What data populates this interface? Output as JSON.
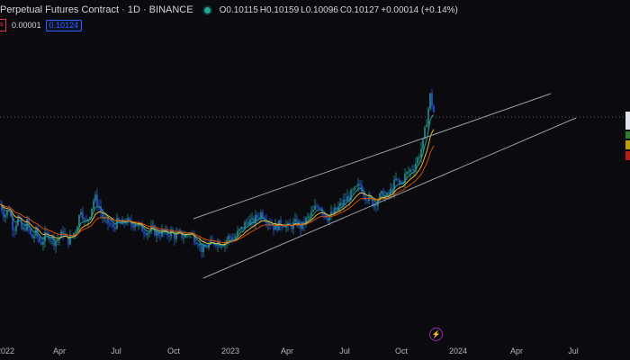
{
  "header": {
    "title": "Perpetual Futures Contract · 1D · BINANCE",
    "ohlc": {
      "open": "O0.10115",
      "high": "H0.10159",
      "low": "L0.10096",
      "close": "C0.10127",
      "change": "+0.00014 (+0.14%)"
    }
  },
  "indicator": {
    "value": "0.00001",
    "price_box": "0.10124"
  },
  "colors": {
    "up": "#26a69a",
    "down": "#2962ff",
    "ema_fast": "#26a69a",
    "ema_mid": "#fbc02d",
    "ema_slow": "#e65100",
    "channel": "#9aa0a6"
  },
  "icons": {
    "status": "status-dot-icon",
    "events": "flash-icon"
  },
  "chart_data": {
    "type": "candlestick",
    "x_ticks": [
      "2022",
      "Apr",
      "Jul",
      "Oct",
      "2023",
      "Apr",
      "Jul",
      "Oct",
      "2024",
      "Apr",
      "Jul"
    ],
    "current_price": 0.10127,
    "grid": false,
    "series": [
      {
        "name": "",
        "kind": "price-path",
        "points": [
          [
            0,
            0.062
          ],
          [
            5,
            0.057
          ],
          [
            10,
            0.06
          ],
          [
            15,
            0.051
          ],
          [
            20,
            0.056
          ],
          [
            25,
            0.05
          ],
          [
            30,
            0.054
          ],
          [
            35,
            0.047
          ],
          [
            40,
            0.05
          ],
          [
            45,
            0.045
          ],
          [
            50,
            0.048
          ],
          [
            55,
            0.049
          ],
          [
            60,
            0.046
          ],
          [
            65,
            0.047
          ],
          [
            70,
            0.05
          ],
          [
            75,
            0.046
          ],
          [
            80,
            0.048
          ],
          [
            85,
            0.052
          ],
          [
            90,
            0.06
          ],
          [
            95,
            0.053
          ],
          [
            100,
            0.058
          ],
          [
            105,
            0.065
          ],
          [
            110,
            0.061
          ],
          [
            115,
            0.055
          ],
          [
            120,
            0.054
          ],
          [
            125,
            0.052
          ],
          [
            130,
            0.054
          ],
          [
            135,
            0.053
          ],
          [
            140,
            0.055
          ],
          [
            145,
            0.053
          ],
          [
            150,
            0.054
          ],
          [
            155,
            0.052
          ],
          [
            160,
            0.051
          ],
          [
            165,
            0.05
          ],
          [
            170,
            0.051
          ],
          [
            175,
            0.049
          ],
          [
            180,
            0.05
          ],
          [
            185,
            0.049
          ],
          [
            190,
            0.05
          ],
          [
            195,
            0.048
          ],
          [
            200,
            0.049
          ],
          [
            205,
            0.048
          ],
          [
            210,
            0.05
          ],
          [
            215,
            0.048
          ],
          [
            220,
            0.046
          ],
          [
            225,
            0.042
          ],
          [
            230,
            0.044
          ],
          [
            235,
            0.045
          ],
          [
            240,
            0.046
          ],
          [
            245,
            0.045
          ],
          [
            250,
            0.046
          ],
          [
            255,
            0.048
          ],
          [
            260,
            0.047
          ],
          [
            265,
            0.05
          ],
          [
            270,
            0.052
          ],
          [
            275,
            0.055
          ],
          [
            280,
            0.054
          ],
          [
            285,
            0.056
          ],
          [
            290,
            0.058
          ],
          [
            295,
            0.056
          ],
          [
            300,
            0.054
          ],
          [
            305,
            0.052
          ],
          [
            310,
            0.053
          ],
          [
            315,
            0.054
          ],
          [
            320,
            0.052
          ],
          [
            325,
            0.053
          ],
          [
            330,
            0.054
          ],
          [
            335,
            0.052
          ],
          [
            340,
            0.055
          ],
          [
            345,
            0.057
          ],
          [
            350,
            0.06
          ],
          [
            355,
            0.062
          ],
          [
            360,
            0.058
          ],
          [
            365,
            0.056
          ],
          [
            370,
            0.058
          ],
          [
            375,
            0.06
          ],
          [
            380,
            0.062
          ],
          [
            385,
            0.064
          ],
          [
            390,
            0.066
          ],
          [
            395,
            0.068
          ],
          [
            400,
            0.07
          ],
          [
            405,
            0.066
          ],
          [
            410,
            0.064
          ],
          [
            415,
            0.062
          ],
          [
            420,
            0.064
          ],
          [
            425,
            0.066
          ],
          [
            430,
            0.065
          ],
          [
            435,
            0.068
          ],
          [
            440,
            0.072
          ],
          [
            445,
            0.07
          ],
          [
            450,
            0.074
          ],
          [
            455,
            0.076
          ],
          [
            460,
            0.078
          ],
          [
            465,
            0.082
          ],
          [
            470,
            0.088
          ],
          [
            475,
            0.1
          ],
          [
            478,
            0.108
          ],
          [
            482,
            0.101
          ]
        ]
      }
    ]
  }
}
